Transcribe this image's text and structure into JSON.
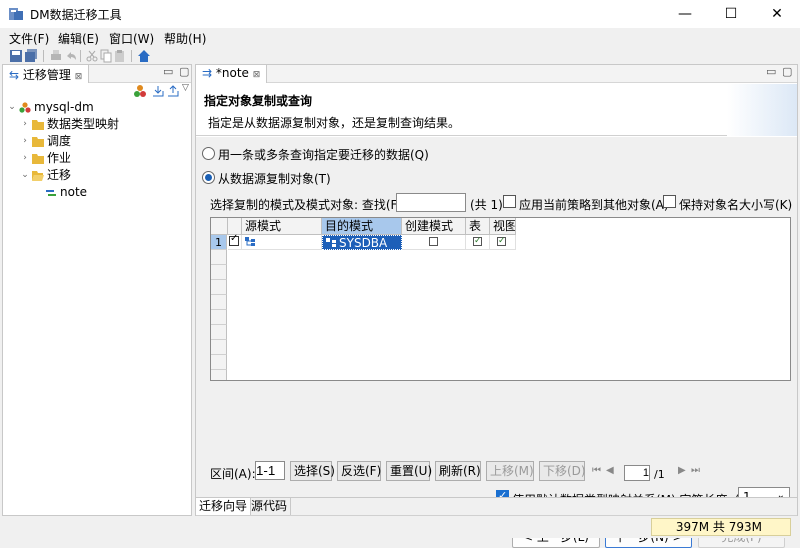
{
  "window": {
    "title": "DM数据迁移工具",
    "minimize": "—",
    "maximize": "☐",
    "close": "✕"
  },
  "menu": [
    "文件(F)",
    "编辑(E)",
    "窗口(W)",
    "帮助(H)"
  ],
  "left_panel": {
    "tab_label": "迁移管理",
    "tab_close": "⊠",
    "tree": [
      {
        "label": "mysql-dm",
        "level": 0,
        "expanded": true,
        "icon": "cluster-icon"
      },
      {
        "label": "数据类型映射",
        "level": 1,
        "expanded": false,
        "icon": "folder-icon"
      },
      {
        "label": "调度",
        "level": 1,
        "expanded": false,
        "icon": "folder-icon"
      },
      {
        "label": "作业",
        "level": 1,
        "expanded": false,
        "icon": "folder-icon"
      },
      {
        "label": "迁移",
        "level": 1,
        "expanded": true,
        "icon": "folder-open-icon"
      },
      {
        "label": "note",
        "level": 2,
        "expanded": null,
        "icon": "migration-icon"
      }
    ]
  },
  "editor": {
    "tab_label": "*note",
    "tab_close": "⊠",
    "header_title": "指定对象复制或查询",
    "header_subtitle": "指定是从数据源复制对象，还是复制查询结果。",
    "option_query": "用一条或多条查询指定要迁移的数据(Q)",
    "option_copy": "从数据源复制对象(T)",
    "select_label": "选择复制的模式及模式对象: 查找(F):",
    "search_value": "",
    "count_text": "(共 1)",
    "apply_policy_label": "应用当前策略到其他对象(A)",
    "keep_case_label": "保持对象名大小写(K)",
    "grid": {
      "columns": [
        "源模式",
        "目的模式",
        "创建模式",
        "表",
        "视图"
      ],
      "rows": [
        {
          "num": "1",
          "checked": true,
          "source": "",
          "target": "SYSDBA",
          "create": false,
          "table": true,
          "view": true
        }
      ]
    },
    "range_label": "区间(A):",
    "range_value": "1-1",
    "buttons": {
      "select": "选择(S)",
      "invert": "反选(F)",
      "reset": "重置(U)",
      "refresh": "刷新(R)",
      "move_up": "上移(M)",
      "move_down": "下移(D)"
    },
    "pager": {
      "first": "⏮",
      "prev": "◀",
      "page": "1",
      "total": "/1",
      "next": "▶",
      "last": "⏭"
    },
    "default_mapping_label": "使用默认数据类型映射关系(M) 字符长度x(L):",
    "default_mapping_checked": true,
    "char_length_value": "1",
    "nav": {
      "prev": "< 上一步(L)",
      "next": "下一步(N) >",
      "finish": "完成(F)"
    },
    "bottom_tabs": [
      "迁移向导",
      "源代码"
    ]
  },
  "status": {
    "heap": "397M 共 793M"
  },
  "colors": {
    "accent": "#1a6fd0",
    "selected_header": "#a8c8ec",
    "selected_cell": "#1d5fb8",
    "heap_bg": "#fff6c8"
  }
}
